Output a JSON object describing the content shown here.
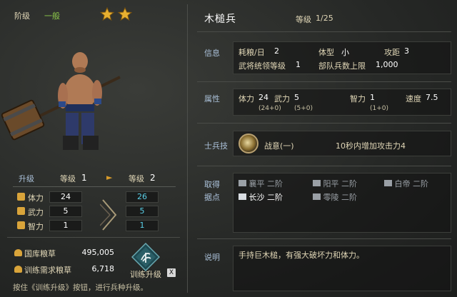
{
  "left": {
    "tier_label": "阶级",
    "tier_value": "一般",
    "star_count": 2,
    "star_icon": "star-icon",
    "upgrade": {
      "title": "升级",
      "level_label": "等级",
      "current_level": "1",
      "next_level": "2",
      "arrow": "►"
    },
    "stats": [
      {
        "name": "体力",
        "icon": "heart-icon",
        "current": "24",
        "next": "26"
      },
      {
        "name": "武力",
        "icon": "fist-icon",
        "current": "5",
        "next": "5"
      },
      {
        "name": "智力",
        "icon": "brain-icon",
        "current": "1",
        "next": "1"
      }
    ],
    "resources": [
      {
        "name": "国库粮草",
        "icon": "grain-icon",
        "value": "495,005"
      },
      {
        "name": "训练需求粮草",
        "icon": "grain-icon",
        "value": "6,718"
      }
    ],
    "train_button_label": "训练升级",
    "train_hotkey": "X",
    "hint": "按住《训练升级》按钮，进行兵种升级。"
  },
  "right": {
    "unit_name": "木槌兵",
    "level_label": "等级",
    "level_value": "1/25",
    "info": {
      "title": "信息",
      "items": [
        {
          "label": "耗粮/日",
          "value": "2"
        },
        {
          "label": "体型",
          "value": "小"
        },
        {
          "label": "攻距",
          "value": "3"
        },
        {
          "label": "武将统领等级",
          "value": "1"
        },
        {
          "label": "部队兵数上限",
          "value": "1,000"
        }
      ]
    },
    "attributes": {
      "title": "属性",
      "items": [
        {
          "label": "体力",
          "value": "24",
          "sub": "(24+0)"
        },
        {
          "label": "武力",
          "value": "5",
          "sub": "(5+0)"
        },
        {
          "label": "智力",
          "value": "1",
          "sub": "(1+0)"
        },
        {
          "label": "速度",
          "value": "7.5",
          "sub": ""
        }
      ]
    },
    "skill": {
      "title": "士兵技",
      "name": "战意(一)",
      "desc": "10秒内增加攻击力4",
      "icon": "skill-icon"
    },
    "acquire": {
      "title_line1": "取得",
      "title_line2": "据点",
      "cities": [
        {
          "name": "襄平",
          "tier": "二阶",
          "active": false
        },
        {
          "name": "阳平",
          "tier": "二阶",
          "active": false
        },
        {
          "name": "白帝",
          "tier": "二阶",
          "active": false
        },
        {
          "name": "长沙",
          "tier": "二阶",
          "active": true
        },
        {
          "name": "零陵",
          "tier": "二阶",
          "active": false
        }
      ]
    },
    "description": {
      "title": "说明",
      "text": "手持巨木槌，有强大破坏力和体力。"
    }
  },
  "colors": {
    "accent_gold": "#d89b2a",
    "tier_green": "#8cc84a",
    "next_stat_cyan": "#5ad0e8",
    "section_title_blue": "#aac0d8"
  }
}
